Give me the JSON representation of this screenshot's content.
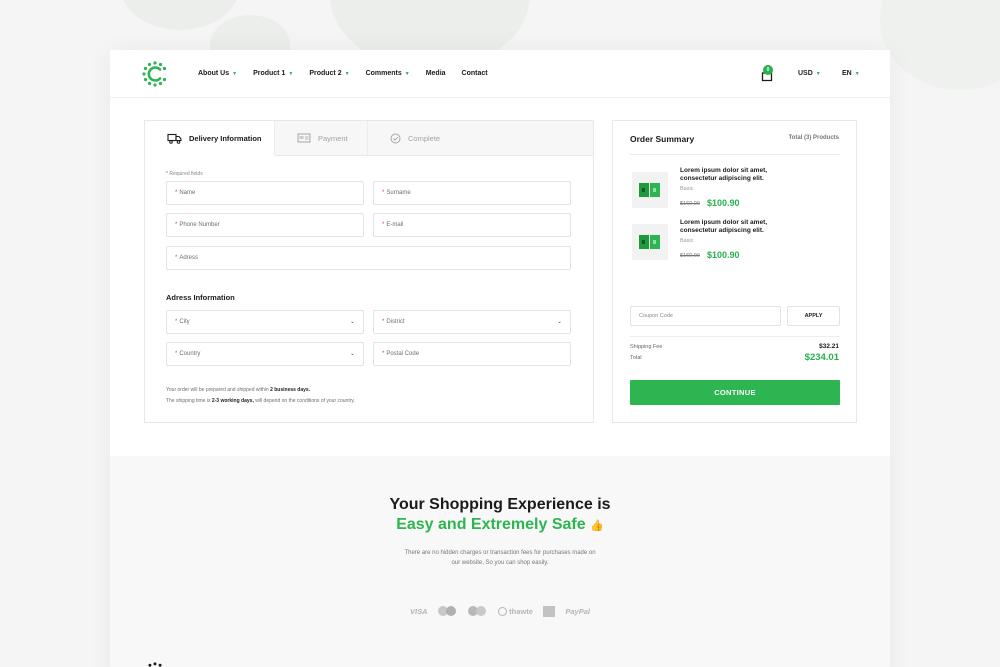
{
  "header": {
    "nav": [
      {
        "label": "About Us",
        "dropdown": true
      },
      {
        "label": "Product 1",
        "dropdown": true
      },
      {
        "label": "Product 2",
        "dropdown": true
      },
      {
        "label": "Comments",
        "dropdown": true
      },
      {
        "label": "Media",
        "dropdown": false
      },
      {
        "label": "Contact",
        "dropdown": false
      }
    ],
    "cart_count": "0",
    "currency": "USD",
    "language": "EN"
  },
  "checkout": {
    "tabs": [
      {
        "label": "Delivery Information",
        "icon": "delivery-truck-icon",
        "active": true
      },
      {
        "label": "Payment",
        "icon": "card-icon",
        "active": false
      },
      {
        "label": "Complete",
        "icon": "check-circle-icon",
        "active": false
      }
    ],
    "required_note": "Required fields",
    "fields": {
      "name": "Name",
      "surname": "Surname",
      "phone": "Phone Number",
      "email": "E-mail",
      "address": "Adress",
      "city": "City",
      "district": "District",
      "country": "Country",
      "postal": "Postal Code"
    },
    "address_title": "Adress Information",
    "note1": {
      "pre": "Your order will be prepared and shipped within ",
      "bold": "2 business days.",
      "post": ""
    },
    "note2": {
      "pre": "The shipping time is ",
      "bold1": "2-3",
      "mid": " ",
      "bold2": "working days,",
      "post": " will depend on the conditions of your country."
    }
  },
  "summary": {
    "title": "Order Summary",
    "total_products": "Total (3) Products",
    "products": [
      {
        "name": "Lorem ipsum dolor sit amet, consectetur adipiscing elit.",
        "variant": "Basic",
        "old_price": "$160,00",
        "price": "$100.90"
      },
      {
        "name": "Lorem ipsum dolor sit amet, consectetur adipiscing elit.",
        "variant": "Basic",
        "old_price": "$160,00",
        "price": "$100.90"
      }
    ],
    "coupon_placeholder": "Coupon Code",
    "apply_label": "APPLY",
    "shipping_label": "Shipping Fee",
    "shipping_value": "$32.21",
    "total_label": "Total",
    "total_value": "$234.01",
    "continue_label": "CONTINUE"
  },
  "promo": {
    "title_line1": "Your Shopping Experience is",
    "title_line2": "Easy and Extremely Safe",
    "text": "There are no hidden charges or transaction fees for purchases made on our website, So you can shop easily.",
    "payments": [
      "VISA",
      "mastercard",
      "maestro",
      "thawte",
      "amex",
      "PayPal"
    ]
  },
  "colors": {
    "accent": "#2cb550",
    "required": "#e33c3c"
  }
}
